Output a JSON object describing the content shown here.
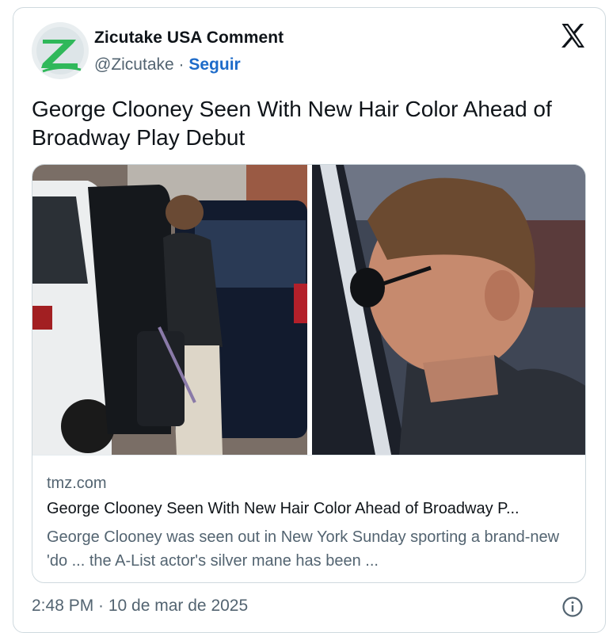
{
  "author": {
    "name": "Zicutake USA Comment",
    "handle": "@Zicutake",
    "separator": "·",
    "follow_label": "Seguir",
    "avatar_letter": "Z",
    "avatar_color": "#2fb85a"
  },
  "brand_icon": "x-logo-icon",
  "tweet": {
    "text": "George Clooney Seen With New Hair Color Ahead of Broadway Play Debut"
  },
  "link_card": {
    "images": [
      "photo-man-at-suv",
      "photo-closeup-sunglasses"
    ],
    "domain": "tmz.com",
    "title": "George Clooney Seen With New Hair Color Ahead of Broadway P...",
    "description": "George Clooney was seen out in New York Sunday sporting a brand-new 'do ... the A-List actor's silver mane has been ..."
  },
  "footer": {
    "timestamp": "2:48 PM · 10 de mar de 2025",
    "info_icon": "info-icon"
  },
  "colors": {
    "follow": "#1d6bc9",
    "muted": "#536471",
    "border": "#cfd9de"
  }
}
